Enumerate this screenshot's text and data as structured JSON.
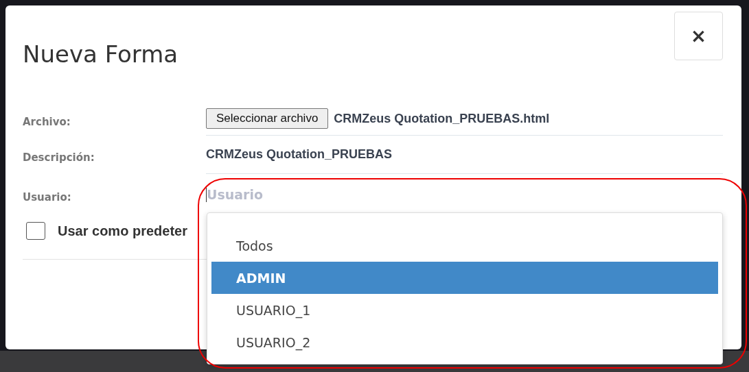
{
  "dialog": {
    "title": "Nueva Forma",
    "close_label": "×"
  },
  "fields": [
    {
      "kind": "file",
      "label": "Archivo:",
      "button": "Seleccionar archivo",
      "file_name": "CRMZeus Quotation_PRUEBAS.html"
    },
    {
      "kind": "text",
      "label": "Descripción:",
      "value": "CRMZeus Quotation_PRUEBAS"
    },
    {
      "kind": "select",
      "label": "Usuario:",
      "placeholder": "Usuario",
      "options": [
        {
          "label": "Todos",
          "selected": false
        },
        {
          "label": "ADMIN",
          "selected": true
        },
        {
          "label": "USUARIO_1",
          "selected": false
        },
        {
          "label": "USUARIO_2",
          "selected": false
        }
      ]
    }
  ],
  "default_checkbox": {
    "label": "Usar como predeter",
    "checked": false
  },
  "annotation": {
    "kind": "outline"
  }
}
